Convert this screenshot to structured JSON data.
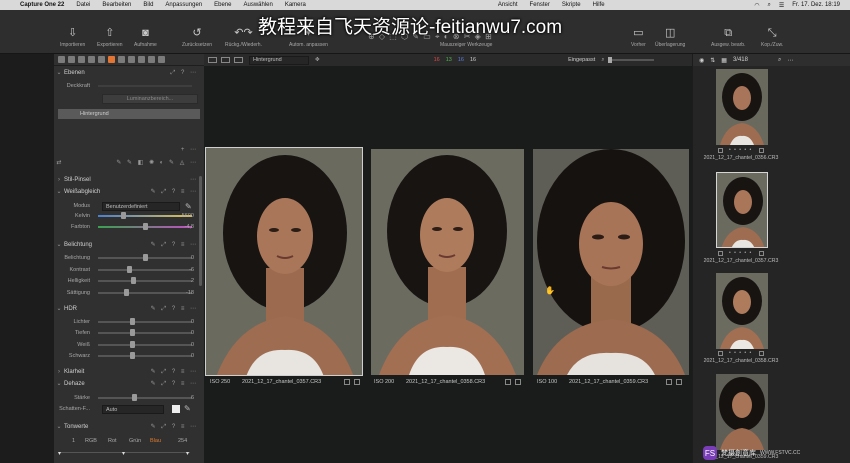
{
  "menubar": {
    "app": "Capture One 22",
    "items": [
      "Datei",
      "Bearbeiten",
      "Bild",
      "Anpassungen",
      "Ebene",
      "Auswählen",
      "Kamera",
      "Ansicht",
      "Fenster",
      "Skripte",
      "Hilfe"
    ],
    "datetime": "Fr. 17. Dez.  18:19"
  },
  "toolbar": {
    "left": [
      {
        "icon": "import-icon",
        "label": "Importieren"
      },
      {
        "icon": "export-icon",
        "label": "Exportieren"
      },
      {
        "icon": "camera-icon",
        "label": "Aufnahme"
      },
      {
        "icon": "reset-icon",
        "label": "Zurücksetzen"
      },
      {
        "icon": "undo-icon",
        "label": "Rückg./Wiederh."
      },
      {
        "icon": "auto-adjust-icon",
        "label": "Autom. anpassen"
      }
    ],
    "center_label": "Mauszeiger Werkzeuge",
    "right": [
      {
        "icon": "before-icon",
        "label": "Vorher"
      },
      {
        "icon": "overlay-icon",
        "label": "Überlagerung"
      },
      {
        "icon": "edit-icon",
        "label": "Ausgew. bearb."
      },
      {
        "icon": "copy-icon",
        "label": "Kop./Zuw."
      }
    ]
  },
  "watermark": "教程来自飞天资源论-feitianwu7.com",
  "left_panel": {
    "ebenen": {
      "title": "Ebenen",
      "deckkraft_label": "Deckkraft",
      "luminanz_button": "Luminanzbereich...",
      "layer": "Hintergrund"
    },
    "stil_pinsel": "Stil-Pinsel",
    "weissabgleich": {
      "title": "Weißabgleich",
      "modus_label": "Modus",
      "modus_value": "Benutzerdefiniert",
      "rows": [
        {
          "label": "Kelvin",
          "value": "5600",
          "pos": 0.45
        },
        {
          "label": "Farbton",
          "value": "-4,8",
          "pos": 0.48
        }
      ]
    },
    "belichtung": {
      "title": "Belichtung",
      "rows": [
        {
          "label": "Belichtung",
          "value": "0",
          "pos": 0.5
        },
        {
          "label": "Kontrast",
          "value": "-6",
          "pos": 0.47
        },
        {
          "label": "Helligkeit",
          "value": "2",
          "pos": 0.51
        },
        {
          "label": "Sättigung",
          "value": "-18",
          "pos": 0.44
        }
      ]
    },
    "hdr": {
      "title": "HDR",
      "rows": [
        {
          "label": "Lichter",
          "value": "0",
          "pos": 0.5
        },
        {
          "label": "Tiefen",
          "value": "0",
          "pos": 0.5
        },
        {
          "label": "Weiß",
          "value": "0",
          "pos": 0.5
        },
        {
          "label": "Schwarz",
          "value": "0",
          "pos": 0.5
        }
      ]
    },
    "klarheit": "Klarheit",
    "dehaze": {
      "title": "Dehaze",
      "staerke_label": "Stärke",
      "staerke_value": "6",
      "schatten_label": "Schatten-F...",
      "schatten_value": "Auto"
    },
    "tonwerte": {
      "title": "Tonwerte",
      "low": "1",
      "high": "254",
      "channels": [
        "RGB",
        "Rot",
        "Grün",
        "Blau"
      ],
      "active_channel": "Blau"
    }
  },
  "viewer_toolbar": {
    "layer_select": "Hintergrund",
    "counts": [
      "16",
      "13",
      "16",
      "16"
    ],
    "count_colors": [
      "#e04848",
      "#4fb84f",
      "#5b7fe0",
      "#cfcfcf"
    ],
    "fit": "Eingepasst"
  },
  "viewer": {
    "images": [
      {
        "iso": "ISO 250",
        "file": "2021_12_17_chantel_0357.CR3",
        "selected": true
      },
      {
        "iso": "ISO 200",
        "file": "2021_12_17_chantel_0358.CR3",
        "selected": false
      },
      {
        "iso": "ISO 100",
        "file": "2021_12_17_chantel_0359.CR3",
        "selected": false
      }
    ]
  },
  "browser": {
    "count": "3/418",
    "thumbs": [
      {
        "file": "2021_12_17_chantel_0356.CR3"
      },
      {
        "file": "2021_12_17_chantel_0357.CR3",
        "selected": true
      },
      {
        "file": "2021_12_17_chantel_0358.CR3"
      },
      {
        "file": "2021_12_17_chantel_0359.CR3"
      }
    ]
  },
  "logo": {
    "badge": "FS",
    "text": "梵摄創意库",
    "url": "WWW.FSTVC.CC"
  }
}
